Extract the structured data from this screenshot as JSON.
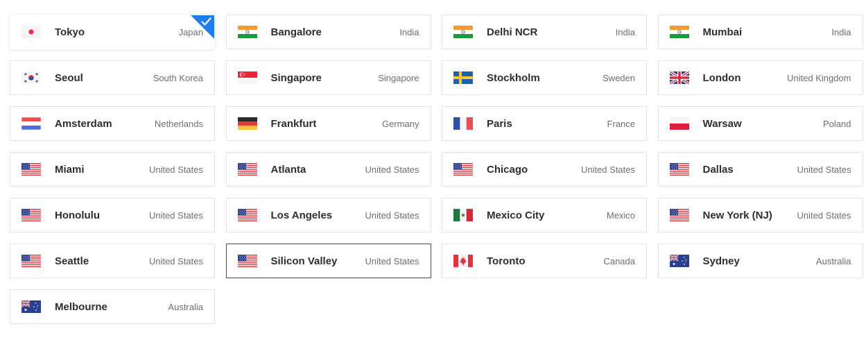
{
  "selected_index": 0,
  "hovered_index": 21,
  "colors": {
    "accent": "#1e7ef0",
    "border": "#e2e4e8",
    "hover_border": "#4a4a4a",
    "city_text": "#2b2e33",
    "country_text": "#6a6f76"
  },
  "locations": [
    {
      "city": "Tokyo",
      "country": "Japan",
      "flag": "jp"
    },
    {
      "city": "Bangalore",
      "country": "India",
      "flag": "in"
    },
    {
      "city": "Delhi NCR",
      "country": "India",
      "flag": "in"
    },
    {
      "city": "Mumbai",
      "country": "India",
      "flag": "in"
    },
    {
      "city": "Seoul",
      "country": "South Korea",
      "flag": "kr"
    },
    {
      "city": "Singapore",
      "country": "Singapore",
      "flag": "sg"
    },
    {
      "city": "Stockholm",
      "country": "Sweden",
      "flag": "se"
    },
    {
      "city": "London",
      "country": "United Kingdom",
      "flag": "gb"
    },
    {
      "city": "Amsterdam",
      "country": "Netherlands",
      "flag": "nl"
    },
    {
      "city": "Frankfurt",
      "country": "Germany",
      "flag": "de"
    },
    {
      "city": "Paris",
      "country": "France",
      "flag": "fr"
    },
    {
      "city": "Warsaw",
      "country": "Poland",
      "flag": "pl"
    },
    {
      "city": "Miami",
      "country": "United States",
      "flag": "us"
    },
    {
      "city": "Atlanta",
      "country": "United States",
      "flag": "us"
    },
    {
      "city": "Chicago",
      "country": "United States",
      "flag": "us"
    },
    {
      "city": "Dallas",
      "country": "United States",
      "flag": "us"
    },
    {
      "city": "Honolulu",
      "country": "United States",
      "flag": "us"
    },
    {
      "city": "Los Angeles",
      "country": "United States",
      "flag": "us"
    },
    {
      "city": "Mexico City",
      "country": "Mexico",
      "flag": "mx"
    },
    {
      "city": "New York (NJ)",
      "country": "United States",
      "flag": "us"
    },
    {
      "city": "Seattle",
      "country": "United States",
      "flag": "us"
    },
    {
      "city": "Silicon Valley",
      "country": "United States",
      "flag": "us"
    },
    {
      "city": "Toronto",
      "country": "Canada",
      "flag": "ca"
    },
    {
      "city": "Sydney",
      "country": "Australia",
      "flag": "au"
    },
    {
      "city": "Melbourne",
      "country": "Australia",
      "flag": "au"
    }
  ]
}
